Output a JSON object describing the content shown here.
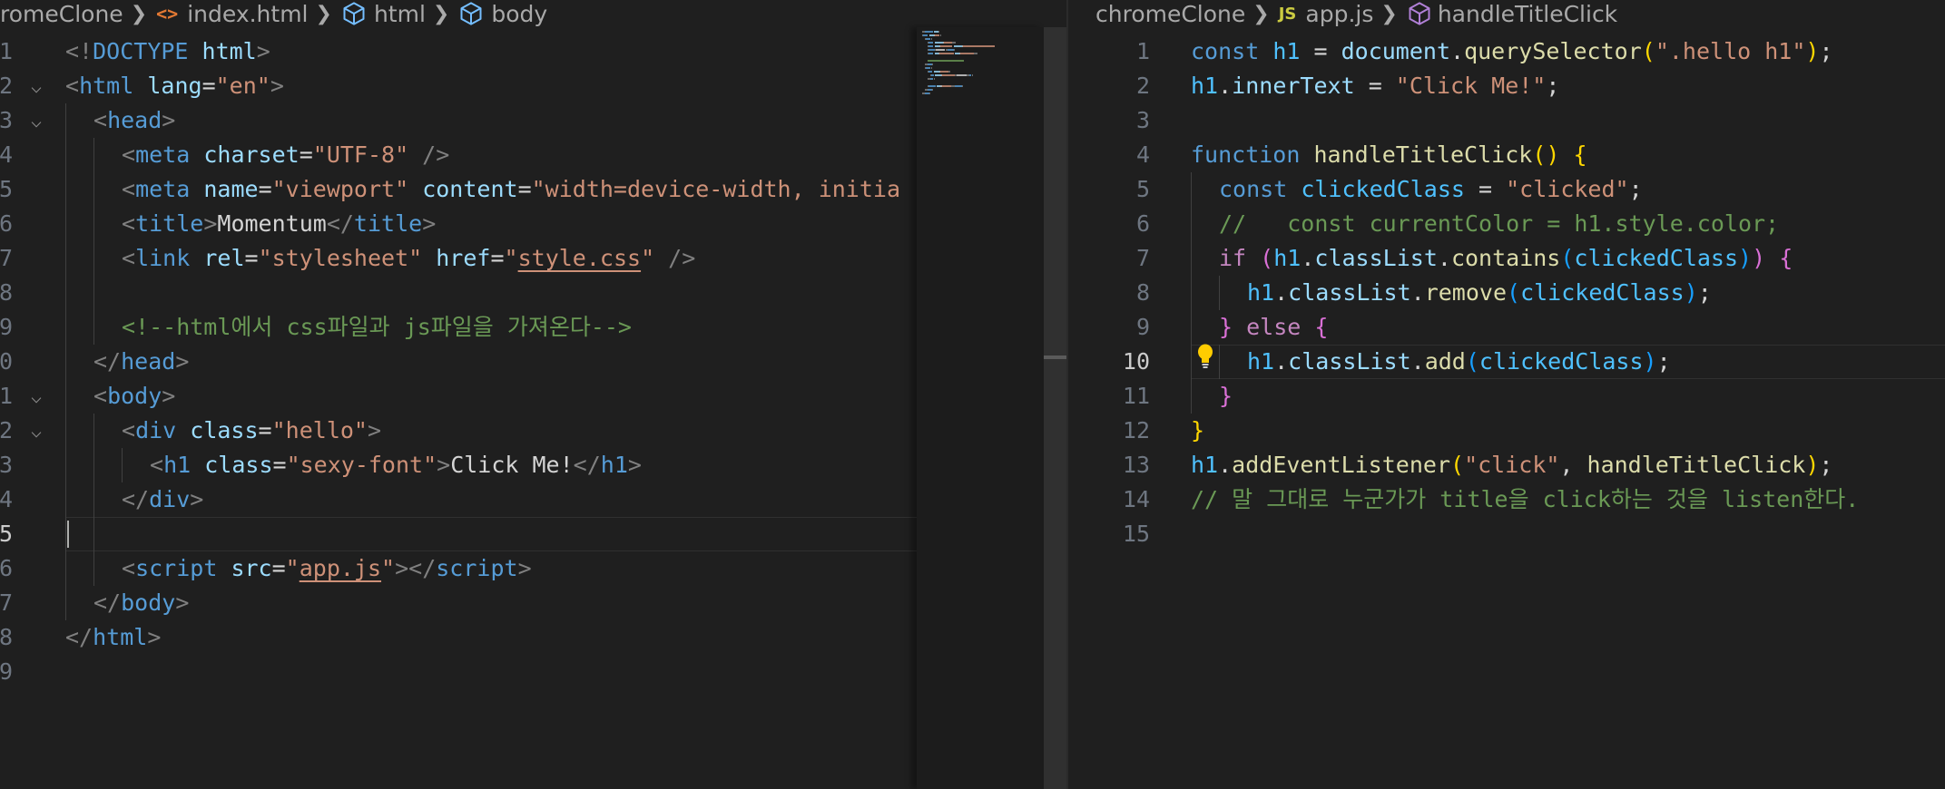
{
  "left_editor": {
    "breadcrumb": {
      "folder": "romeClone",
      "file_icon": "html-file-icon",
      "file": "index.html",
      "symbol_1": "html",
      "symbol_2": "body"
    },
    "active_line": 15,
    "lines": [
      {
        "n": "1",
        "tokens": [
          [
            "<!",
            "punc"
          ],
          [
            "DOCTYPE",
            "tag"
          ],
          [
            " ",
            "txt"
          ],
          [
            "html",
            "attr"
          ],
          [
            ">",
            "punc"
          ]
        ]
      },
      {
        "n": "2",
        "fold": true,
        "tokens": [
          [
            "<",
            "punc"
          ],
          [
            "html",
            "tag"
          ],
          [
            " ",
            "txt"
          ],
          [
            "lang",
            "attr"
          ],
          [
            "=",
            "txt"
          ],
          [
            "\"en\"",
            "str"
          ],
          [
            ">",
            "punc"
          ]
        ]
      },
      {
        "n": "3",
        "fold": true,
        "indent": 1,
        "tokens": [
          [
            "<",
            "punc"
          ],
          [
            "head",
            "tag"
          ],
          [
            ">",
            "punc"
          ]
        ]
      },
      {
        "n": "4",
        "indent": 2,
        "tokens": [
          [
            "<",
            "punc"
          ],
          [
            "meta",
            "tag"
          ],
          [
            " ",
            "txt"
          ],
          [
            "charset",
            "attr"
          ],
          [
            "=",
            "txt"
          ],
          [
            "\"UTF-8\"",
            "str"
          ],
          [
            " />",
            "punc"
          ]
        ]
      },
      {
        "n": "5",
        "indent": 2,
        "tokens": [
          [
            "<",
            "punc"
          ],
          [
            "meta",
            "tag"
          ],
          [
            " ",
            "txt"
          ],
          [
            "name",
            "attr"
          ],
          [
            "=",
            "txt"
          ],
          [
            "\"viewport\"",
            "str"
          ],
          [
            " ",
            "txt"
          ],
          [
            "content",
            "attr"
          ],
          [
            "=",
            "txt"
          ],
          [
            "\"width=device-width, initia",
            "str"
          ]
        ]
      },
      {
        "n": "6",
        "indent": 2,
        "tokens": [
          [
            "<",
            "punc"
          ],
          [
            "title",
            "tag"
          ],
          [
            ">",
            "punc"
          ],
          [
            "Momentum",
            "txt"
          ],
          [
            "</",
            "punc"
          ],
          [
            "title",
            "tag"
          ],
          [
            ">",
            "punc"
          ]
        ]
      },
      {
        "n": "7",
        "indent": 2,
        "tokens": [
          [
            "<",
            "punc"
          ],
          [
            "link",
            "tag"
          ],
          [
            " ",
            "txt"
          ],
          [
            "rel",
            "attr"
          ],
          [
            "=",
            "txt"
          ],
          [
            "\"stylesheet\"",
            "str"
          ],
          [
            " ",
            "txt"
          ],
          [
            "href",
            "attr"
          ],
          [
            "=",
            "txt"
          ],
          [
            "\"",
            "str"
          ],
          [
            "style.css",
            "link"
          ],
          [
            "\"",
            "str"
          ],
          [
            " />",
            "punc"
          ]
        ]
      },
      {
        "n": "8",
        "indent": 2,
        "tokens": []
      },
      {
        "n": "9",
        "indent": 2,
        "tokens": [
          [
            "<!--html에서 css파일과 js파일을 가져온다-->",
            "cmt"
          ]
        ]
      },
      {
        "n": "0",
        "indent": 1,
        "tokens": [
          [
            "</",
            "punc"
          ],
          [
            "head",
            "tag"
          ],
          [
            ">",
            "punc"
          ]
        ]
      },
      {
        "n": "1",
        "fold": true,
        "indent": 1,
        "tokens": [
          [
            "<",
            "punc"
          ],
          [
            "body",
            "tag"
          ],
          [
            ">",
            "punc"
          ]
        ]
      },
      {
        "n": "2",
        "fold": true,
        "indent": 2,
        "tokens": [
          [
            "<",
            "punc"
          ],
          [
            "div",
            "tag"
          ],
          [
            " ",
            "txt"
          ],
          [
            "class",
            "attr"
          ],
          [
            "=",
            "txt"
          ],
          [
            "\"hello\"",
            "str"
          ],
          [
            ">",
            "punc"
          ]
        ]
      },
      {
        "n": "3",
        "indent": 3,
        "tokens": [
          [
            "<",
            "punc"
          ],
          [
            "h1",
            "tag"
          ],
          [
            " ",
            "txt"
          ],
          [
            "class",
            "attr"
          ],
          [
            "=",
            "txt"
          ],
          [
            "\"sexy-font\"",
            "str"
          ],
          [
            ">",
            "punc"
          ],
          [
            "Click Me!",
            "txt"
          ],
          [
            "</",
            "punc"
          ],
          [
            "h1",
            "tag"
          ],
          [
            ">",
            "punc"
          ]
        ]
      },
      {
        "n": "4",
        "indent": 2,
        "tokens": [
          [
            "</",
            "punc"
          ],
          [
            "div",
            "tag"
          ],
          [
            ">",
            "punc"
          ]
        ]
      },
      {
        "n": "5",
        "indent": 2,
        "tokens": []
      },
      {
        "n": "6",
        "indent": 2,
        "tokens": [
          [
            "<",
            "punc"
          ],
          [
            "script",
            "tag"
          ],
          [
            " ",
            "txt"
          ],
          [
            "src",
            "attr"
          ],
          [
            "=",
            "txt"
          ],
          [
            "\"",
            "str"
          ],
          [
            "app.js",
            "link"
          ],
          [
            "\"",
            "str"
          ],
          [
            "></",
            "punc"
          ],
          [
            "script",
            "tag"
          ],
          [
            ">",
            "punc"
          ]
        ]
      },
      {
        "n": "7",
        "indent": 1,
        "tokens": [
          [
            "</",
            "punc"
          ],
          [
            "body",
            "tag"
          ],
          [
            ">",
            "punc"
          ]
        ]
      },
      {
        "n": "8",
        "tokens": [
          [
            "</",
            "punc"
          ],
          [
            "html",
            "tag"
          ],
          [
            ">",
            "punc"
          ]
        ]
      },
      {
        "n": "9",
        "tokens": []
      }
    ]
  },
  "right_editor": {
    "breadcrumb": {
      "folder": "chromeClone",
      "file_icon_label": "JS",
      "file": "app.js",
      "symbol": "handleTitleClick"
    },
    "active_line": 10,
    "lines": [
      {
        "n": "1",
        "tokens": [
          [
            "const",
            "kw"
          ],
          [
            " ",
            "txt"
          ],
          [
            "h1",
            "var"
          ],
          [
            " = ",
            "op"
          ],
          [
            "document",
            "prop"
          ],
          [
            ".",
            "op"
          ],
          [
            "querySelector",
            "fn"
          ],
          [
            "(",
            "b1"
          ],
          [
            "\".hello h1\"",
            "str"
          ],
          [
            ")",
            "b1"
          ],
          [
            ";",
            "op"
          ]
        ]
      },
      {
        "n": "2",
        "tokens": [
          [
            "h1",
            "var"
          ],
          [
            ".",
            "op"
          ],
          [
            "innerText",
            "prop"
          ],
          [
            " = ",
            "op"
          ],
          [
            "\"Click Me!\"",
            "str"
          ],
          [
            ";",
            "op"
          ]
        ]
      },
      {
        "n": "3",
        "tokens": []
      },
      {
        "n": "4",
        "tokens": [
          [
            "function",
            "kw"
          ],
          [
            " ",
            "txt"
          ],
          [
            "handleTitleClick",
            "fn"
          ],
          [
            "()",
            "b1"
          ],
          [
            " ",
            "txt"
          ],
          [
            "{",
            "b1"
          ]
        ]
      },
      {
        "n": "5",
        "indent": 1,
        "tokens": [
          [
            "const",
            "kw"
          ],
          [
            " ",
            "txt"
          ],
          [
            "clickedClass",
            "var"
          ],
          [
            " = ",
            "op"
          ],
          [
            "\"clicked\"",
            "str"
          ],
          [
            ";",
            "op"
          ]
        ]
      },
      {
        "n": "6",
        "indent": 1,
        "tokens": [
          [
            "//   const currentColor = h1.style.color;",
            "cmt"
          ]
        ]
      },
      {
        "n": "7",
        "indent": 1,
        "tokens": [
          [
            "if",
            "ctl"
          ],
          [
            " ",
            "txt"
          ],
          [
            "(",
            "b2"
          ],
          [
            "h1",
            "var"
          ],
          [
            ".",
            "op"
          ],
          [
            "classList",
            "prop"
          ],
          [
            ".",
            "op"
          ],
          [
            "contains",
            "fn"
          ],
          [
            "(",
            "b3"
          ],
          [
            "clickedClass",
            "var"
          ],
          [
            ")",
            "b3"
          ],
          [
            ")",
            "b2"
          ],
          [
            " ",
            "txt"
          ],
          [
            "{",
            "b2"
          ]
        ]
      },
      {
        "n": "8",
        "indent": 2,
        "tokens": [
          [
            "h1",
            "var"
          ],
          [
            ".",
            "op"
          ],
          [
            "classList",
            "prop"
          ],
          [
            ".",
            "op"
          ],
          [
            "remove",
            "fn"
          ],
          [
            "(",
            "b3"
          ],
          [
            "clickedClass",
            "var"
          ],
          [
            ")",
            "b3"
          ],
          [
            ";",
            "op"
          ]
        ]
      },
      {
        "n": "9",
        "indent": 1,
        "tokens": [
          [
            "}",
            "b2"
          ],
          [
            " ",
            "txt"
          ],
          [
            "else",
            "ctl"
          ],
          [
            " ",
            "txt"
          ],
          [
            "{",
            "b2"
          ]
        ]
      },
      {
        "n": "10",
        "indent": 2,
        "tokens": [
          [
            "h1",
            "var"
          ],
          [
            ".",
            "op"
          ],
          [
            "classList",
            "prop"
          ],
          [
            ".",
            "op"
          ],
          [
            "add",
            "fn"
          ],
          [
            "(",
            "b3"
          ],
          [
            "clickedClass",
            "var"
          ],
          [
            ")",
            "b3"
          ],
          [
            ";",
            "op"
          ]
        ]
      },
      {
        "n": "11",
        "indent": 1,
        "tokens": [
          [
            "}",
            "b2"
          ]
        ]
      },
      {
        "n": "12",
        "tokens": [
          [
            "}",
            "b1"
          ]
        ]
      },
      {
        "n": "13",
        "tokens": [
          [
            "h1",
            "var"
          ],
          [
            ".",
            "op"
          ],
          [
            "addEventListener",
            "fn"
          ],
          [
            "(",
            "b1"
          ],
          [
            "\"click\"",
            "str"
          ],
          [
            ", ",
            "op"
          ],
          [
            "handleTitleClick",
            "fn"
          ],
          [
            ")",
            "b1"
          ],
          [
            ";",
            "op"
          ]
        ]
      },
      {
        "n": "14",
        "tokens": [
          [
            "// 말 그대로 누군가가 title을 click하는 것을 listen한다.",
            "cmt"
          ]
        ]
      },
      {
        "n": "15",
        "tokens": []
      }
    ]
  },
  "icons": {
    "left_file_icon": "html-file-icon",
    "left_symbol_icon": "symbol-cube-icon",
    "right_file_icon": "js-file-icon",
    "right_symbol_icon": "function-cube-icon",
    "lightbulb": "lightbulb-icon"
  },
  "colors": {
    "background": "#1f1f1f",
    "tag": "#569cd6",
    "attribute": "#9cdcfe",
    "string": "#ce9178",
    "comment": "#6a9955",
    "function": "#dcdcaa",
    "control": "#c586c0",
    "variable": "#4fc1ff",
    "bracket_1": "#ffd700",
    "bracket_2": "#da70d6",
    "bracket_3": "#179fff",
    "lightbulb": "#ffcc00"
  }
}
